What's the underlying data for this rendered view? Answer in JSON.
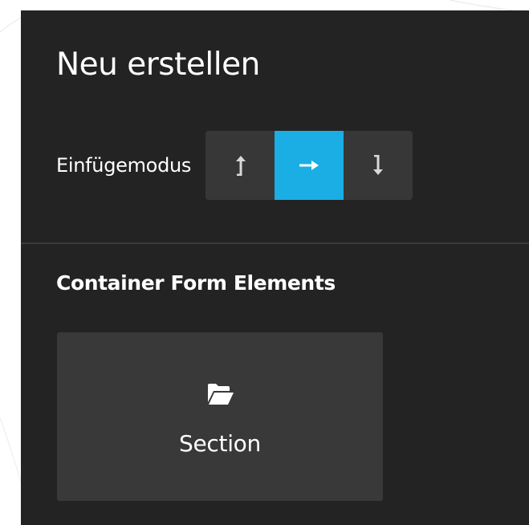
{
  "panel": {
    "title": "Neu erstellen",
    "insert_mode": {
      "label": "Einfügemodus",
      "options": [
        {
          "icon": "insert-above-icon",
          "active": false
        },
        {
          "icon": "insert-replace-icon",
          "active": true
        },
        {
          "icon": "insert-below-icon",
          "active": false
        }
      ],
      "active_color": "#1aaee4"
    },
    "sections": [
      {
        "heading": "Container Form Elements",
        "items": [
          {
            "label": "Section",
            "icon": "folder-open-icon"
          }
        ]
      }
    ]
  },
  "colors": {
    "panel_background": "#232323",
    "button_background": "#373737",
    "tile_background": "#393939",
    "text": "#ffffff",
    "accent": "#1aaee4"
  }
}
